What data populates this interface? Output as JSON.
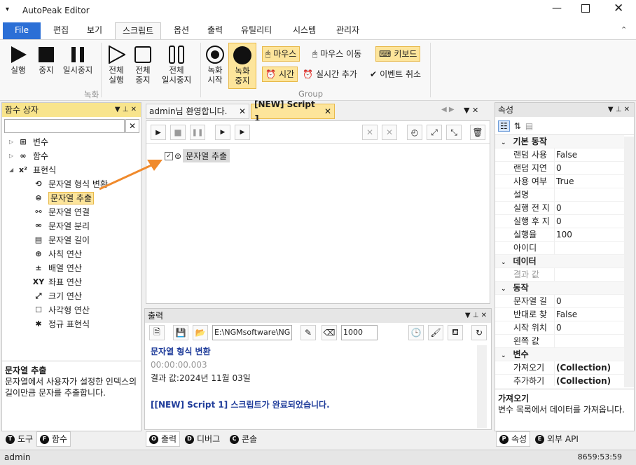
{
  "app": {
    "title": "AutoPeak Editor"
  },
  "menu": {
    "tabs": [
      "File",
      "편집",
      "보기",
      "스크립트",
      "옵션",
      "출력",
      "유틸리티",
      "시스템",
      "관리자"
    ]
  },
  "ribbon": {
    "buttons": [
      {
        "label1": "실행",
        "label2": ""
      },
      {
        "label1": "중지",
        "label2": ""
      },
      {
        "label1": "일시중지",
        "label2": ""
      },
      {
        "label1": "전체",
        "label2": "실행"
      },
      {
        "label1": "전체",
        "label2": "중지"
      },
      {
        "label1": "전체",
        "label2": "일시중지"
      },
      {
        "label1": "녹화",
        "label2": "시작"
      },
      {
        "label1": "녹화",
        "label2": "중지"
      }
    ],
    "group1": "녹화",
    "group2": "Group",
    "small": {
      "mouse": "마우스",
      "mouse_move": "마우스 이동",
      "keyboard": "키보드",
      "time": "시간",
      "realtime_add": "실시간 추가",
      "event_cancel": "이벤트 취소"
    }
  },
  "left": {
    "title": "함수 상자",
    "tree": [
      {
        "label": "변수",
        "level": 0
      },
      {
        "label": "함수",
        "level": 0
      },
      {
        "label": "표현식",
        "level": 0
      },
      {
        "label": "문자열 형식 변환",
        "level": 1
      },
      {
        "label": "문자열 추출",
        "level": 1,
        "selected": true
      },
      {
        "label": "문자열 연결",
        "level": 1
      },
      {
        "label": "문자열 분리",
        "level": 1
      },
      {
        "label": "문자열 길이",
        "level": 1
      },
      {
        "label": "사칙 연산",
        "level": 1
      },
      {
        "label": "배열 연산",
        "level": 1
      },
      {
        "label": "좌표 연산",
        "level": 1
      },
      {
        "label": "크기 연산",
        "level": 1
      },
      {
        "label": "사각형 연산",
        "level": 1
      },
      {
        "label": "정규 표현식",
        "level": 1
      }
    ],
    "desc_title": "문자열 추출",
    "desc_text": "문자열에서 사용자가 설정한 인덱스의 길이만큼 문자를 추출합니다.",
    "tabs": [
      "도구",
      "함수"
    ]
  },
  "editor": {
    "tabs": [
      "admin님 환영합니다.",
      "[NEW] Script 1"
    ],
    "node": "문자열 추출"
  },
  "output": {
    "title": "출력",
    "path": "E:\\NGMsoftware\\NG",
    "count": "1000",
    "lines": [
      "문자열 형식 변환",
      "00:00:00.003",
      "결과 값:2024년 11월 03일",
      "",
      "[[NEW] Script 1] 스크립트가 완료되었습니다."
    ],
    "tabs": [
      "출력",
      "디버그",
      "콘솔"
    ]
  },
  "props": {
    "title": "속성",
    "rows": [
      {
        "cat": "기본 동작"
      },
      {
        "k": "랜덤 사용",
        "v": "False"
      },
      {
        "k": "랜덤 지연",
        "v": "0"
      },
      {
        "k": "사용 여부",
        "v": "True"
      },
      {
        "k": "설명",
        "v": ""
      },
      {
        "k": "실행 전 지",
        "v": "0"
      },
      {
        "k": "실행 후 지",
        "v": "0"
      },
      {
        "k": "실행율",
        "v": "100"
      },
      {
        "k": "아이디",
        "v": ""
      },
      {
        "cat": "데이터"
      },
      {
        "k": "결과 값",
        "v": "",
        "dim": true
      },
      {
        "cat": "동작"
      },
      {
        "k": "문자열 길",
        "v": "0"
      },
      {
        "k": "반대로 찾",
        "v": "False"
      },
      {
        "k": "시작 위치",
        "v": "0"
      },
      {
        "k": "왼쪽 값",
        "v": ""
      },
      {
        "cat": "변수"
      },
      {
        "k": "가져오기",
        "v": "(Collection)",
        "bold": true
      },
      {
        "k": "추가하기",
        "v": "(Collection)",
        "bold": true
      }
    ],
    "desc_title": "가져오기",
    "desc_text": "변수 목록에서 데이터를 가져옵니다.",
    "tabs": [
      "속성",
      "외부 API"
    ]
  },
  "status": {
    "user": "admin",
    "time": "8659:53:59"
  }
}
